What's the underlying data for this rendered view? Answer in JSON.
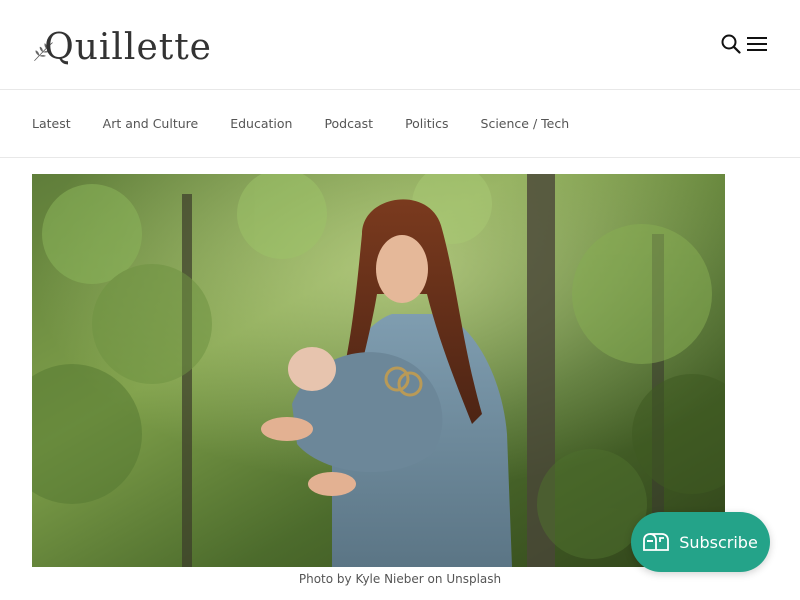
{
  "site": {
    "name": "Quillette"
  },
  "nav": {
    "items": [
      {
        "label": "Latest"
      },
      {
        "label": "Art and Culture"
      },
      {
        "label": "Education"
      },
      {
        "label": "Podcast"
      },
      {
        "label": "Politics"
      },
      {
        "label": "Science / Tech"
      }
    ]
  },
  "header": {
    "search_icon": "search-icon",
    "menu_icon": "hamburger-menu-icon"
  },
  "hero": {
    "caption_prefix": "Photo by",
    "caption_author": "Kyle Nieber",
    "caption_on": "on",
    "caption_source": "Unsplash"
  },
  "subscribe": {
    "label": "Subscribe",
    "icon": "mailbox-icon",
    "color": "#24a389"
  }
}
